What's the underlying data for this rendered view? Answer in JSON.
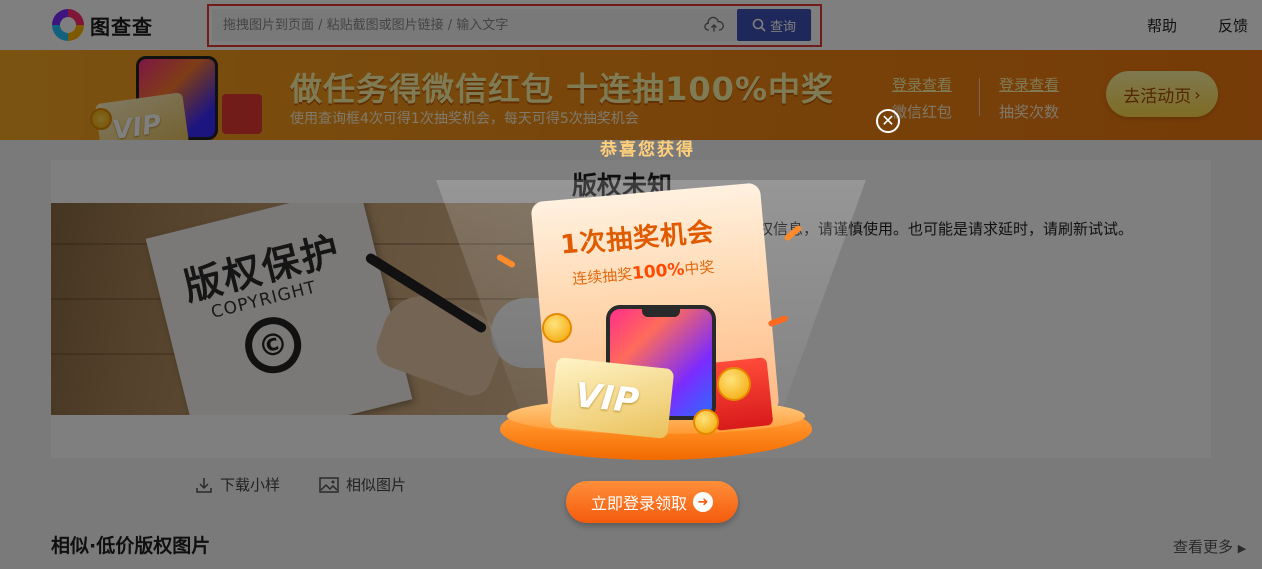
{
  "header": {
    "logo_text": "图查查",
    "search": {
      "placeholder": "拖拽图片到页面 / 粘贴截图或图片链接 / 输入文字",
      "button_label": "查询",
      "upload_icon": "cloud-upload-icon",
      "search_icon": "magnifier-icon"
    },
    "nav": [
      {
        "label": "帮助"
      },
      {
        "label": "反馈"
      }
    ],
    "highlight_color": "#e53935",
    "accent_color": "#3f51b5"
  },
  "banner": {
    "title": "做任务得微信红包 十连抽100%中奖",
    "subtitle": "使用查询框4次可得1次抽奖机会，每天可得5次抽奖机会",
    "stats": [
      {
        "login_label": "登录查看",
        "description": "微信红包"
      },
      {
        "login_label": "登录查看",
        "description": "抽奖次数"
      }
    ],
    "cta_label": "去活动页",
    "cta_icon": "chevron-right-icon",
    "vip_text": "VIP"
  },
  "main": {
    "title": "版权未知",
    "description": "版权信息，请谨慎使用。也可能是请求延时，请刷新试试。",
    "image": {
      "headline": "版权保护",
      "caption": "COPYRIGHT",
      "symbol": "©"
    },
    "actions": [
      {
        "label": "下载小样",
        "icon": "download-icon"
      },
      {
        "label": "相似图片",
        "icon": "image-icon"
      }
    ]
  },
  "similar_section": {
    "title": "相似·低价版权图片",
    "more_label": "查看更多",
    "more_icon": "triangle-right-icon"
  },
  "modal": {
    "congrats": "恭喜您获得",
    "prize_title": "1次抽奖机会",
    "prize_sub_prefix": "连续抽奖",
    "prize_sub_highlight": "100%",
    "prize_sub_suffix": "中奖",
    "vip_text": "VIP",
    "claim_label": "立即登录领取",
    "claim_icon": "arrow-right-circle-icon",
    "close_icon": "close-icon"
  }
}
